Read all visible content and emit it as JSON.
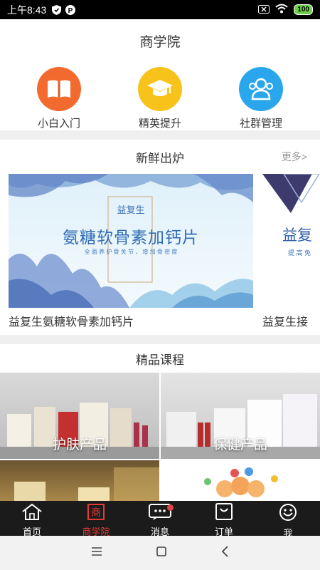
{
  "status_bar": {
    "time": "上午8:43",
    "battery": "100"
  },
  "header": {
    "title": "商学院"
  },
  "nav": [
    {
      "label": "小白入门",
      "icon": "book-icon",
      "color": "#f26a2e"
    },
    {
      "label": "精英提升",
      "icon": "graduation-cap-icon",
      "color": "#f7c31b"
    },
    {
      "label": "社群管理",
      "icon": "group-icon",
      "color": "#2aa7ec"
    }
  ],
  "fresh": {
    "title": "新鲜出炉",
    "more": "更多>",
    "banners": [
      {
        "brand": "益复生",
        "headline": "氨糖软骨素加钙片",
        "tagline": "全 面 养 护 骨 关 节 ， 增 加 骨 密 度",
        "caption": "益复生氨糖软骨素加钙片"
      },
      {
        "brand": "益复",
        "tagline": "提 高 免",
        "caption": "益复生接"
      }
    ]
  },
  "courses": {
    "title": "精品课程",
    "items": [
      {
        "label": "护肤产品"
      },
      {
        "label": "保健产品"
      },
      {
        "label": ""
      },
      {
        "label": ""
      }
    ]
  },
  "tabs": [
    {
      "label": "首页",
      "icon": "home-icon"
    },
    {
      "label": "商学院",
      "icon": "academy-icon",
      "active": true
    },
    {
      "label": "消息",
      "icon": "message-icon",
      "badge": true
    },
    {
      "label": "订单",
      "icon": "bag-icon"
    },
    {
      "label": "我",
      "icon": "smiley-icon"
    }
  ],
  "colors": {
    "accent": "#e23b37",
    "tab_bg": "#1b1b1b"
  }
}
